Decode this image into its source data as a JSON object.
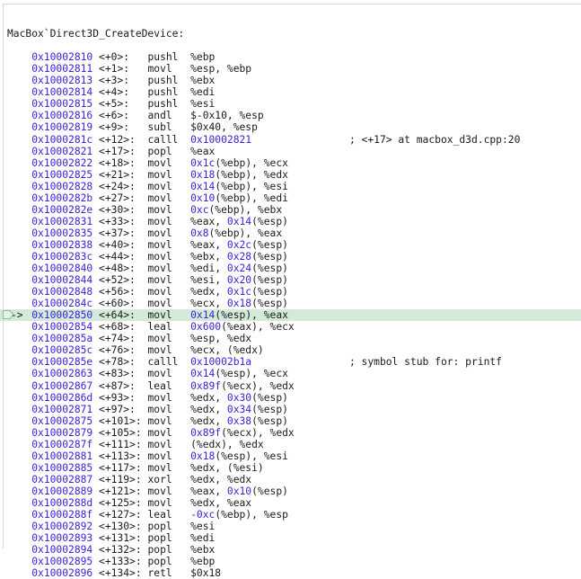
{
  "header": "MacBox`Direct3D_CreateDevice:",
  "current_arrow": "->",
  "colors": {
    "address": "#3b22d6",
    "highlight": "#d3e9d9"
  },
  "lines": [
    {
      "address": "0x10002810",
      "offset": "<+0>:",
      "mnemonic": "pushl",
      "operands": "%ebp"
    },
    {
      "address": "0x10002811",
      "offset": "<+1>:",
      "mnemonic": "movl",
      "operands": "%esp, %ebp"
    },
    {
      "address": "0x10002813",
      "offset": "<+3>:",
      "mnemonic": "pushl",
      "operands": "%ebx"
    },
    {
      "address": "0x10002814",
      "offset": "<+4>:",
      "mnemonic": "pushl",
      "operands": "%edi"
    },
    {
      "address": "0x10002815",
      "offset": "<+5>:",
      "mnemonic": "pushl",
      "operands": "%esi"
    },
    {
      "address": "0x10002816",
      "offset": "<+6>:",
      "mnemonic": "andl",
      "operands": "$-0x10, %esp"
    },
    {
      "address": "0x10002819",
      "offset": "<+9>:",
      "mnemonic": "subl",
      "operands": "$0x40, %esp"
    },
    {
      "address": "0x1000281c",
      "offset": "<+12>:",
      "mnemonic": "calll",
      "operands": "0x10002821",
      "comment": "; <+17> at macbox_d3d.cpp:20"
    },
    {
      "address": "0x10002821",
      "offset": "<+17>:",
      "mnemonic": "popl",
      "operands": "%eax"
    },
    {
      "address": "0x10002822",
      "offset": "<+18>:",
      "mnemonic": "movl",
      "operands": "0x1c(%ebp), %ecx"
    },
    {
      "address": "0x10002825",
      "offset": "<+21>:",
      "mnemonic": "movl",
      "operands": "0x18(%ebp), %edx"
    },
    {
      "address": "0x10002828",
      "offset": "<+24>:",
      "mnemonic": "movl",
      "operands": "0x14(%ebp), %esi"
    },
    {
      "address": "0x1000282b",
      "offset": "<+27>:",
      "mnemonic": "movl",
      "operands": "0x10(%ebp), %edi"
    },
    {
      "address": "0x1000282e",
      "offset": "<+30>:",
      "mnemonic": "movl",
      "operands": "0xc(%ebp), %ebx"
    },
    {
      "address": "0x10002831",
      "offset": "<+33>:",
      "mnemonic": "movl",
      "operands": "%eax, 0x14(%esp)"
    },
    {
      "address": "0x10002835",
      "offset": "<+37>:",
      "mnemonic": "movl",
      "operands": "0x8(%ebp), %eax"
    },
    {
      "address": "0x10002838",
      "offset": "<+40>:",
      "mnemonic": "movl",
      "operands": "%eax, 0x2c(%esp)"
    },
    {
      "address": "0x1000283c",
      "offset": "<+44>:",
      "mnemonic": "movl",
      "operands": "%ebx, 0x28(%esp)"
    },
    {
      "address": "0x10002840",
      "offset": "<+48>:",
      "mnemonic": "movl",
      "operands": "%edi, 0x24(%esp)"
    },
    {
      "address": "0x10002844",
      "offset": "<+52>:",
      "mnemonic": "movl",
      "operands": "%esi, 0x20(%esp)"
    },
    {
      "address": "0x10002848",
      "offset": "<+56>:",
      "mnemonic": "movl",
      "operands": "%edx, 0x1c(%esp)"
    },
    {
      "address": "0x1000284c",
      "offset": "<+60>:",
      "mnemonic": "movl",
      "operands": "%ecx, 0x18(%esp)"
    },
    {
      "address": "0x10002850",
      "offset": "<+64>:",
      "mnemonic": "movl",
      "operands": "0x14(%esp), %eax",
      "current": true
    },
    {
      "address": "0x10002854",
      "offset": "<+68>:",
      "mnemonic": "leal",
      "operands": "0x600(%eax), %ecx"
    },
    {
      "address": "0x1000285a",
      "offset": "<+74>:",
      "mnemonic": "movl",
      "operands": "%esp, %edx"
    },
    {
      "address": "0x1000285c",
      "offset": "<+76>:",
      "mnemonic": "movl",
      "operands": "%ecx, (%edx)"
    },
    {
      "address": "0x1000285e",
      "offset": "<+78>:",
      "mnemonic": "calll",
      "operands": "0x10002b1a",
      "comment": "; symbol stub for: printf"
    },
    {
      "address": "0x10002863",
      "offset": "<+83>:",
      "mnemonic": "movl",
      "operands": "0x14(%esp), %ecx"
    },
    {
      "address": "0x10002867",
      "offset": "<+87>:",
      "mnemonic": "leal",
      "operands": "0x89f(%ecx), %edx"
    },
    {
      "address": "0x1000286d",
      "offset": "<+93>:",
      "mnemonic": "movl",
      "operands": "%edx, 0x30(%esp)"
    },
    {
      "address": "0x10002871",
      "offset": "<+97>:",
      "mnemonic": "movl",
      "operands": "%edx, 0x34(%esp)"
    },
    {
      "address": "0x10002875",
      "offset": "<+101>:",
      "mnemonic": "movl",
      "operands": "%edx, 0x38(%esp)"
    },
    {
      "address": "0x10002879",
      "offset": "<+105>:",
      "mnemonic": "movl",
      "operands": "0x89f(%ecx), %edx"
    },
    {
      "address": "0x1000287f",
      "offset": "<+111>:",
      "mnemonic": "movl",
      "operands": "(%edx), %edx"
    },
    {
      "address": "0x10002881",
      "offset": "<+113>:",
      "mnemonic": "movl",
      "operands": "0x18(%esp), %esi"
    },
    {
      "address": "0x10002885",
      "offset": "<+117>:",
      "mnemonic": "movl",
      "operands": "%edx, (%esi)"
    },
    {
      "address": "0x10002887",
      "offset": "<+119>:",
      "mnemonic": "xorl",
      "operands": "%edx, %edx"
    },
    {
      "address": "0x10002889",
      "offset": "<+121>:",
      "mnemonic": "movl",
      "operands": "%eax, 0x10(%esp)"
    },
    {
      "address": "0x1000288d",
      "offset": "<+125>:",
      "mnemonic": "movl",
      "operands": "%edx, %eax"
    },
    {
      "address": "0x1000288f",
      "offset": "<+127>:",
      "mnemonic": "leal",
      "operands": "-0xc(%ebp), %esp"
    },
    {
      "address": "0x10002892",
      "offset": "<+130>:",
      "mnemonic": "popl",
      "operands": "%esi"
    },
    {
      "address": "0x10002893",
      "offset": "<+131>:",
      "mnemonic": "popl",
      "operands": "%edi"
    },
    {
      "address": "0x10002894",
      "offset": "<+132>:",
      "mnemonic": "popl",
      "operands": "%ebx"
    },
    {
      "address": "0x10002895",
      "offset": "<+133>:",
      "mnemonic": "popl",
      "operands": "%ebp"
    },
    {
      "address": "0x10002896",
      "offset": "<+134>:",
      "mnemonic": "retl",
      "operands": "$0x18"
    }
  ]
}
